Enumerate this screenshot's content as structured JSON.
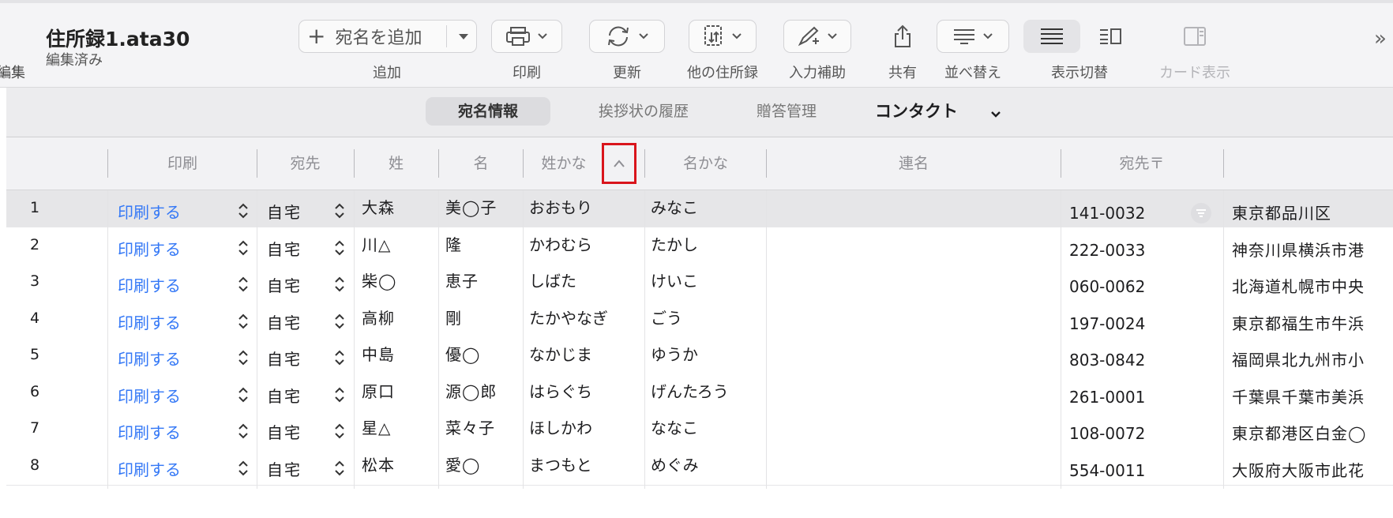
{
  "window": {
    "left_cut_label": "編集",
    "doc_title": "住所録1.ata30",
    "doc_status": "編集済み",
    "more_glyph": "»"
  },
  "toolbar": {
    "add_button_label": "宛名を追加",
    "add_caption": "追加",
    "print_caption": "印刷",
    "update_caption": "更新",
    "other_caption": "他の住所録",
    "assist_caption": "入力補助",
    "share_caption": "共有",
    "sort_caption": "並べ替え",
    "view_toggle_caption": "表示切替",
    "card_caption": "カード表示"
  },
  "tabs": [
    {
      "label": "宛名情報",
      "active": true
    },
    {
      "label": "挨拶状の履歴",
      "active": false
    },
    {
      "label": "贈答管理",
      "active": false
    },
    {
      "label": "コンタクト",
      "active": false
    }
  ],
  "columns": {
    "print": "印刷",
    "dest": "宛先",
    "last": "姓",
    "first": "名",
    "lastkana": "姓かな",
    "firstkana": "名かな",
    "joint": "連名",
    "zip": "宛先〒"
  },
  "sort": {
    "column": "姓かな",
    "direction": "ascending"
  },
  "rows": [
    {
      "num": "1",
      "print": "印刷する",
      "dest": "自宅",
      "last": "大森",
      "first": "美◯子",
      "lastkana": "おおもり",
      "firstkana": "みなこ",
      "zip": "141-0032",
      "addr": "東京都品川区"
    },
    {
      "num": "2",
      "print": "印刷する",
      "dest": "自宅",
      "last": "川△",
      "first": "隆",
      "lastkana": "かわむら",
      "firstkana": "たかし",
      "zip": "222-0033",
      "addr": "神奈川県横浜市港"
    },
    {
      "num": "3",
      "print": "印刷する",
      "dest": "自宅",
      "last": "柴◯",
      "first": "恵子",
      "lastkana": "しばた",
      "firstkana": "けいこ",
      "zip": "060-0062",
      "addr": "北海道札幌市中央"
    },
    {
      "num": "4",
      "print": "印刷する",
      "dest": "自宅",
      "last": "高柳",
      "first": "剛",
      "lastkana": "たかやなぎ",
      "firstkana": "ごう",
      "zip": "197-0024",
      "addr": "東京都福生市牛浜"
    },
    {
      "num": "5",
      "print": "印刷する",
      "dest": "自宅",
      "last": "中島",
      "first": "優◯",
      "lastkana": "なかじま",
      "firstkana": "ゆうか",
      "zip": "803-0842",
      "addr": "福岡県北九州市小"
    },
    {
      "num": "6",
      "print": "印刷する",
      "dest": "自宅",
      "last": "原口",
      "first": "源◯郎",
      "lastkana": "はらぐち",
      "firstkana": "げんたろう",
      "zip": "261-0001",
      "addr": "千葉県千葉市美浜"
    },
    {
      "num": "7",
      "print": "印刷する",
      "dest": "自宅",
      "last": "星△",
      "first": "菜々子",
      "lastkana": "ほしかわ",
      "firstkana": "ななこ",
      "zip": "108-0072",
      "addr": "東京都港区白金◯"
    },
    {
      "num": "8",
      "print": "印刷する",
      "dest": "自宅",
      "last": "松本",
      "first": "愛◯",
      "lastkana": "まつもと",
      "firstkana": "めぐみ",
      "zip": "554-0011",
      "addr": "大阪府大阪市此花"
    }
  ],
  "colors": {
    "accent_link": "#3478f6",
    "highlight_box": "#d9151c",
    "selected_row": "#e6e6e8"
  }
}
